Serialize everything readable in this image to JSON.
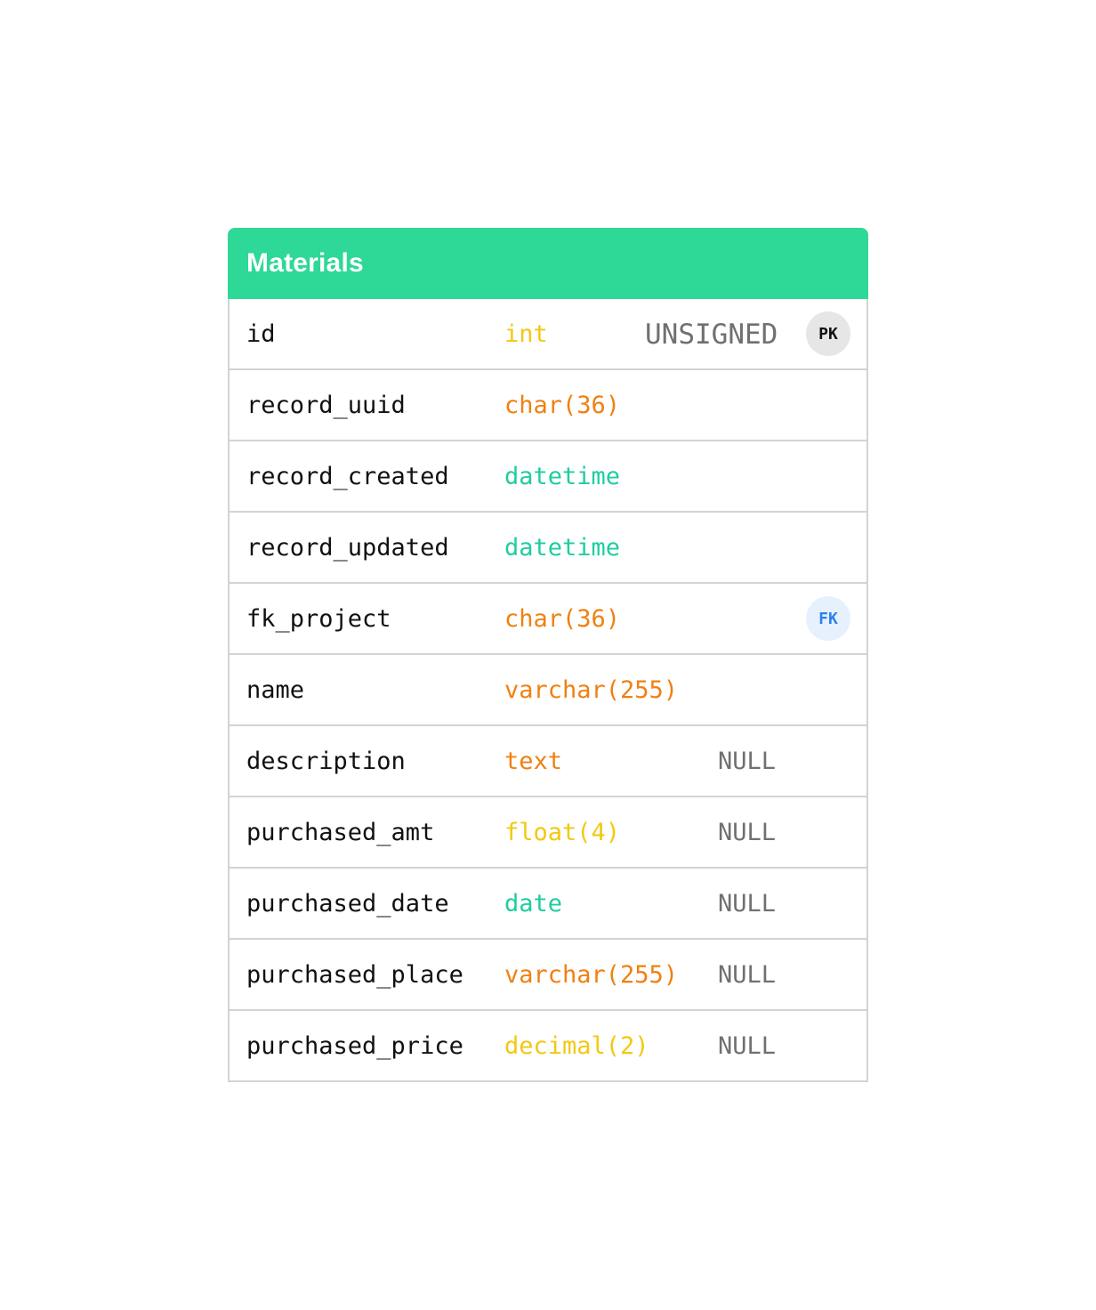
{
  "entity": {
    "title": "Materials",
    "header_color": "#2ed897",
    "type_colors": {
      "integer": "#f2c811",
      "string": "#f08012",
      "temporal": "#1ecda0"
    },
    "columns": [
      {
        "name": "id",
        "type": "int",
        "type_kind": "integer",
        "modifier": "UNSIGNED",
        "key": "PK"
      },
      {
        "name": "record_uuid",
        "type": "char(36)",
        "type_kind": "string",
        "modifier": "",
        "key": ""
      },
      {
        "name": "record_created",
        "type": "datetime",
        "type_kind": "temporal",
        "modifier": "",
        "key": ""
      },
      {
        "name": "record_updated",
        "type": "datetime",
        "type_kind": "temporal",
        "modifier": "",
        "key": ""
      },
      {
        "name": "fk_project",
        "type": "char(36)",
        "type_kind": "string",
        "modifier": "",
        "key": "FK"
      },
      {
        "name": "name",
        "type": "varchar(255)",
        "type_kind": "string",
        "modifier": "",
        "key": ""
      },
      {
        "name": "description",
        "type": "text",
        "type_kind": "string",
        "modifier": "NULL",
        "key": ""
      },
      {
        "name": "purchased_amt",
        "type": "float(4)",
        "type_kind": "integer",
        "modifier": "NULL",
        "key": ""
      },
      {
        "name": "purchased_date",
        "type": "date",
        "type_kind": "temporal",
        "modifier": "NULL",
        "key": ""
      },
      {
        "name": "purchased_place",
        "type": "varchar(255)",
        "type_kind": "string",
        "modifier": "NULL",
        "key": ""
      },
      {
        "name": "purchased_price",
        "type": "decimal(2)",
        "type_kind": "integer",
        "modifier": "NULL",
        "key": ""
      }
    ]
  }
}
